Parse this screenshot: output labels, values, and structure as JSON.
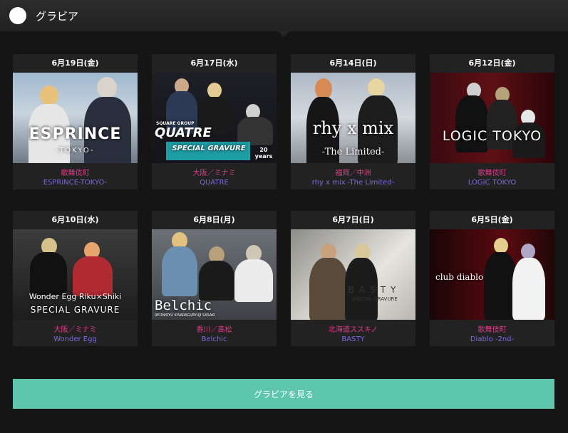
{
  "header": {
    "title": "グラビア"
  },
  "cards": [
    {
      "date": "6月19日(金)",
      "location": "歌舞伎町",
      "shop": "ESPRINCE-TOKYO-",
      "overlay": "ESPRINCE",
      "overlay_sub": "-TOKYO-"
    },
    {
      "date": "6月17日(水)",
      "location": "大阪／ミナミ",
      "shop": "QUATRE",
      "overlay": "QUATRE",
      "overlay_sub": "SPECIAL GRAVURE",
      "overlay_top": "SQUARE GROUP",
      "overlay_badge": "20 years"
    },
    {
      "date": "6月14日(日)",
      "location": "福岡／中洲",
      "shop": "rhy x mix -The Limited-",
      "overlay": "rhy x mix",
      "overlay_sub": "-The Limited-"
    },
    {
      "date": "6月12日(金)",
      "location": "歌舞伎町",
      "shop": "LOGIC TOKYO",
      "overlay": "LOGIC TOKYO"
    },
    {
      "date": "6月10日(水)",
      "location": "大阪／ミナミ",
      "shop": "Wonder Egg",
      "overlay": "Wonder Egg Riku×Shiki",
      "overlay_sub": "SPECIAL GRAVURE"
    },
    {
      "date": "6月8日(月)",
      "location": "香川／高松",
      "shop": "Belchic",
      "overlay": "Belchic",
      "overlay_sub": "REON/RYU KISARAGI/RYUJI SASAKI"
    },
    {
      "date": "6月7日(日)",
      "location": "北海道ススキノ",
      "shop": "BASTY",
      "overlay": "BASTY",
      "overlay_sub": "SPECIAL GRAVURE"
    },
    {
      "date": "6月5日(金)",
      "location": "歌舞伎町",
      "shop": "Diablo -2nd-",
      "overlay": "club diablo"
    }
  ],
  "button": {
    "label": "グラビアを見る"
  }
}
